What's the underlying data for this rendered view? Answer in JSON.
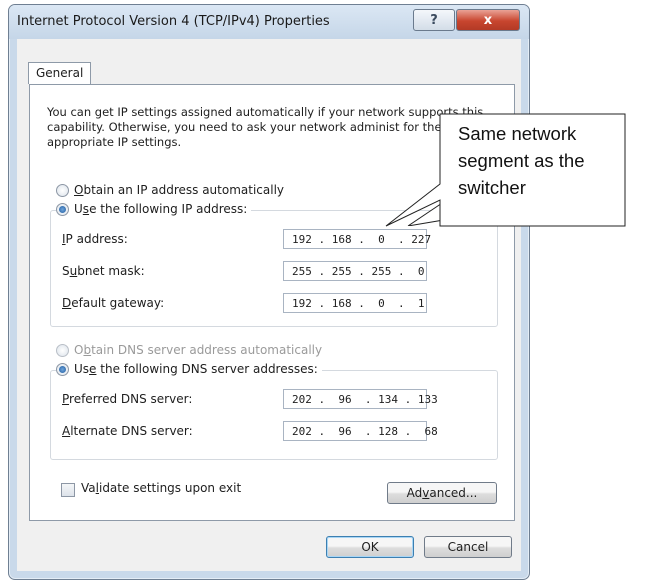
{
  "window": {
    "title": "Internet Protocol Version 4 (TCP/IPv4) Properties",
    "help_icon": "?",
    "close_icon": "x"
  },
  "tabs": [
    {
      "label": "General",
      "selected": true
    }
  ],
  "intro_text": "You can get IP settings assigned automatically if your network supports this capability. Otherwise, you need to ask your network administ for the appropriate IP settings.",
  "ip_section": {
    "obtain_auto": {
      "label_prefix": "",
      "accel": "O",
      "label_rest": "btain an IP address automatically",
      "selected": false
    },
    "use_following": {
      "label_prefix": "U",
      "accel": "s",
      "label_rest": "e the following IP address:",
      "selected": true
    },
    "fields": [
      {
        "label_prefix": "",
        "accel": "I",
        "label_rest": "P address:",
        "value": "192 . 168 .  0  . 227"
      },
      {
        "label_prefix": "S",
        "accel": "u",
        "label_rest": "bnet mask:",
        "value": "255 . 255 . 255 .  0"
      },
      {
        "label_prefix": "",
        "accel": "D",
        "label_rest": "efault gateway:",
        "value": "192 . 168 .  0  .  1"
      }
    ]
  },
  "dns_section": {
    "obtain_auto": {
      "label_prefix": "O",
      "accel": "b",
      "label_rest": "tain DNS server address automatically",
      "selected": false,
      "disabled": true
    },
    "use_following": {
      "label_prefix": "Us",
      "accel": "e",
      "label_rest": " the following DNS server addresses:",
      "selected": true
    },
    "fields": [
      {
        "label_prefix": "",
        "accel": "P",
        "label_rest": "referred DNS server:",
        "value": "202 .  96  . 134 . 133"
      },
      {
        "label_prefix": "",
        "accel": "A",
        "label_rest": "lternate DNS server:",
        "value": "202 .  96  . 128 .  68"
      }
    ]
  },
  "validate": {
    "label_prefix": "Va",
    "accel": "l",
    "label_rest": "idate settings upon exit",
    "checked": false
  },
  "advanced_button": {
    "label_prefix": "Ad",
    "accel": "v",
    "label_rest": "anced..."
  },
  "ok_button": "OK",
  "cancel_button": "Cancel",
  "callout": {
    "text": "Same network\nsegment as the\nswitcher"
  }
}
